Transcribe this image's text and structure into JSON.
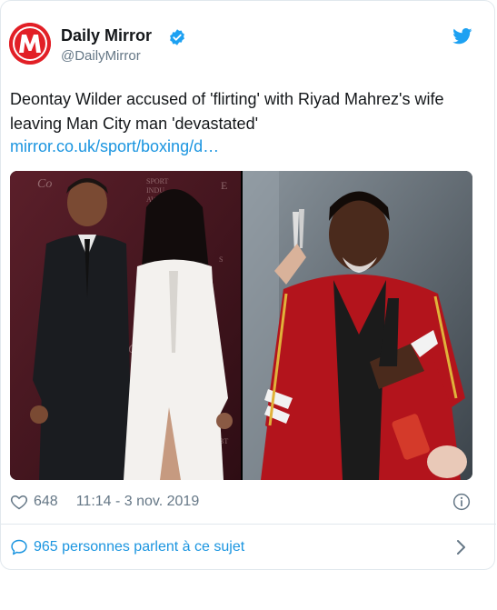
{
  "account": {
    "name": "Daily Mirror",
    "handle": "@DailyMirror",
    "logo_letter": "M",
    "brand_color": "#e21f26"
  },
  "tweet": {
    "text": "Deontay Wilder accused of 'flirting' with Riyad Mahrez's wife leaving Man City man 'devastated'",
    "link": "mirror.co.uk/sport/boxing/d…"
  },
  "meta": {
    "likes": "648",
    "timestamp": "11:14 - 3 nov. 2019"
  },
  "footer": {
    "talking": "965 personnes parlent à ce sujet"
  },
  "colors": {
    "link": "#1b95e0",
    "muted": "#657786",
    "twitter_blue": "#1da1f2"
  },
  "icons": [
    "verified-badge-icon",
    "twitter-bird-icon",
    "heart-icon",
    "info-icon",
    "speech-bubble-icon",
    "chevron-right-icon"
  ]
}
